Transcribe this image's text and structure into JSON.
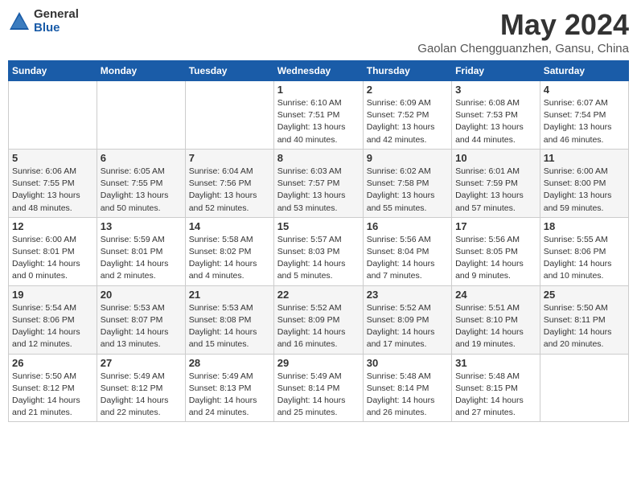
{
  "logo": {
    "general": "General",
    "blue": "Blue"
  },
  "title": "May 2024",
  "subtitle": "Gaolan Chengguanzhen, Gansu, China",
  "days_of_week": [
    "Sunday",
    "Monday",
    "Tuesday",
    "Wednesday",
    "Thursday",
    "Friday",
    "Saturday"
  ],
  "weeks": [
    [
      {
        "day": "",
        "info": ""
      },
      {
        "day": "",
        "info": ""
      },
      {
        "day": "",
        "info": ""
      },
      {
        "day": "1",
        "info": "Sunrise: 6:10 AM\nSunset: 7:51 PM\nDaylight: 13 hours\nand 40 minutes."
      },
      {
        "day": "2",
        "info": "Sunrise: 6:09 AM\nSunset: 7:52 PM\nDaylight: 13 hours\nand 42 minutes."
      },
      {
        "day": "3",
        "info": "Sunrise: 6:08 AM\nSunset: 7:53 PM\nDaylight: 13 hours\nand 44 minutes."
      },
      {
        "day": "4",
        "info": "Sunrise: 6:07 AM\nSunset: 7:54 PM\nDaylight: 13 hours\nand 46 minutes."
      }
    ],
    [
      {
        "day": "5",
        "info": "Sunrise: 6:06 AM\nSunset: 7:55 PM\nDaylight: 13 hours\nand 48 minutes."
      },
      {
        "day": "6",
        "info": "Sunrise: 6:05 AM\nSunset: 7:55 PM\nDaylight: 13 hours\nand 50 minutes."
      },
      {
        "day": "7",
        "info": "Sunrise: 6:04 AM\nSunset: 7:56 PM\nDaylight: 13 hours\nand 52 minutes."
      },
      {
        "day": "8",
        "info": "Sunrise: 6:03 AM\nSunset: 7:57 PM\nDaylight: 13 hours\nand 53 minutes."
      },
      {
        "day": "9",
        "info": "Sunrise: 6:02 AM\nSunset: 7:58 PM\nDaylight: 13 hours\nand 55 minutes."
      },
      {
        "day": "10",
        "info": "Sunrise: 6:01 AM\nSunset: 7:59 PM\nDaylight: 13 hours\nand 57 minutes."
      },
      {
        "day": "11",
        "info": "Sunrise: 6:00 AM\nSunset: 8:00 PM\nDaylight: 13 hours\nand 59 minutes."
      }
    ],
    [
      {
        "day": "12",
        "info": "Sunrise: 6:00 AM\nSunset: 8:01 PM\nDaylight: 14 hours\nand 0 minutes."
      },
      {
        "day": "13",
        "info": "Sunrise: 5:59 AM\nSunset: 8:01 PM\nDaylight: 14 hours\nand 2 minutes."
      },
      {
        "day": "14",
        "info": "Sunrise: 5:58 AM\nSunset: 8:02 PM\nDaylight: 14 hours\nand 4 minutes."
      },
      {
        "day": "15",
        "info": "Sunrise: 5:57 AM\nSunset: 8:03 PM\nDaylight: 14 hours\nand 5 minutes."
      },
      {
        "day": "16",
        "info": "Sunrise: 5:56 AM\nSunset: 8:04 PM\nDaylight: 14 hours\nand 7 minutes."
      },
      {
        "day": "17",
        "info": "Sunrise: 5:56 AM\nSunset: 8:05 PM\nDaylight: 14 hours\nand 9 minutes."
      },
      {
        "day": "18",
        "info": "Sunrise: 5:55 AM\nSunset: 8:06 PM\nDaylight: 14 hours\nand 10 minutes."
      }
    ],
    [
      {
        "day": "19",
        "info": "Sunrise: 5:54 AM\nSunset: 8:06 PM\nDaylight: 14 hours\nand 12 minutes."
      },
      {
        "day": "20",
        "info": "Sunrise: 5:53 AM\nSunset: 8:07 PM\nDaylight: 14 hours\nand 13 minutes."
      },
      {
        "day": "21",
        "info": "Sunrise: 5:53 AM\nSunset: 8:08 PM\nDaylight: 14 hours\nand 15 minutes."
      },
      {
        "day": "22",
        "info": "Sunrise: 5:52 AM\nSunset: 8:09 PM\nDaylight: 14 hours\nand 16 minutes."
      },
      {
        "day": "23",
        "info": "Sunrise: 5:52 AM\nSunset: 8:09 PM\nDaylight: 14 hours\nand 17 minutes."
      },
      {
        "day": "24",
        "info": "Sunrise: 5:51 AM\nSunset: 8:10 PM\nDaylight: 14 hours\nand 19 minutes."
      },
      {
        "day": "25",
        "info": "Sunrise: 5:50 AM\nSunset: 8:11 PM\nDaylight: 14 hours\nand 20 minutes."
      }
    ],
    [
      {
        "day": "26",
        "info": "Sunrise: 5:50 AM\nSunset: 8:12 PM\nDaylight: 14 hours\nand 21 minutes."
      },
      {
        "day": "27",
        "info": "Sunrise: 5:49 AM\nSunset: 8:12 PM\nDaylight: 14 hours\nand 22 minutes."
      },
      {
        "day": "28",
        "info": "Sunrise: 5:49 AM\nSunset: 8:13 PM\nDaylight: 14 hours\nand 24 minutes."
      },
      {
        "day": "29",
        "info": "Sunrise: 5:49 AM\nSunset: 8:14 PM\nDaylight: 14 hours\nand 25 minutes."
      },
      {
        "day": "30",
        "info": "Sunrise: 5:48 AM\nSunset: 8:14 PM\nDaylight: 14 hours\nand 26 minutes."
      },
      {
        "day": "31",
        "info": "Sunrise: 5:48 AM\nSunset: 8:15 PM\nDaylight: 14 hours\nand 27 minutes."
      },
      {
        "day": "",
        "info": ""
      }
    ]
  ]
}
